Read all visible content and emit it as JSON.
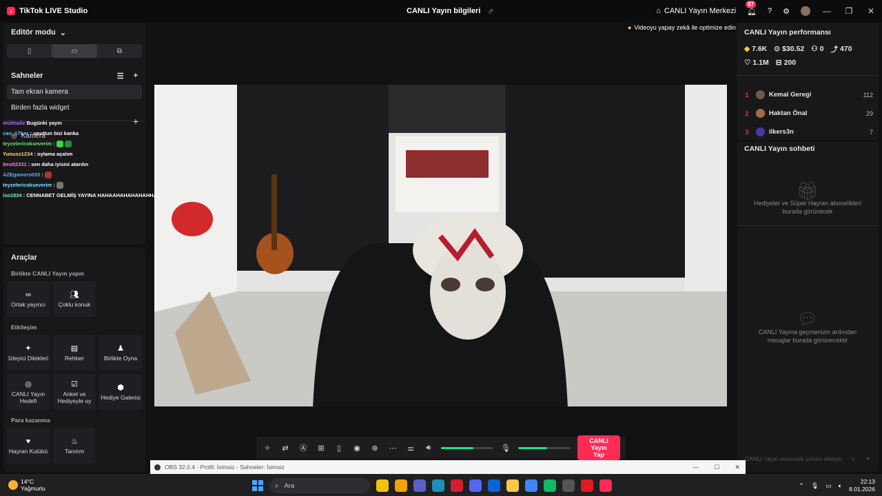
{
  "app": {
    "title": "TikTok LIVE Studio",
    "header_title": "CANLI Yayın bilgileri",
    "live_center": "CANLI Yayın Merkezi",
    "notification_count": "87"
  },
  "editor": {
    "mode_label": "Editör modu",
    "scenes_label": "Sahneler",
    "scenes": [
      "Tam ekran kamera",
      "Birden fazla widget"
    ],
    "camera_source": "Kamera"
  },
  "overlay_chat": [
    {
      "user": "mu̇fmaliz",
      "msg": "Bugünki yayın",
      "cls": "u1"
    },
    {
      "user": "can_17hnr",
      "msg": ": unuttun bizi kanka",
      "cls": "u2"
    },
    {
      "user": "teyzelericokseverim",
      "msg": ":",
      "cls": "u7"
    },
    {
      "user": "Yunuss1234",
      "msg": ": oylama açalım",
      "cls": "u4"
    },
    {
      "user": "bestt2331",
      "msg": ": sen daha iyisini atardın",
      "cls": "u5"
    },
    {
      "user": "AZEgamers033",
      "msg": ":",
      "cls": "u6"
    },
    {
      "user": "teyzelericokseverim",
      "msg": ":",
      "cls": "u7"
    },
    {
      "user": "iso1834",
      "msg": ": CENNABET GELMİŞ YAYINA HAHAAHAHAHAHAHHA",
      "cls": "u8"
    }
  ],
  "tools": {
    "title": "Araçlar",
    "sections": [
      {
        "label": "Birlikte CANLI Yayın yapın",
        "items": [
          {
            "label": "Ortak yayıncı",
            "icon": "link-icon"
          },
          {
            "label": "Çoklu konuk",
            "icon": "users-icon"
          }
        ]
      },
      {
        "label": "Etkileşim",
        "items": [
          {
            "label": "İzleyici Dilekleri",
            "icon": "wish-icon"
          },
          {
            "label": "Rehber",
            "icon": "book-icon"
          },
          {
            "label": "Birlikte Oyna",
            "icon": "play-together-icon"
          },
          {
            "label": "CANLI Yayın Hedefi",
            "icon": "target-icon"
          },
          {
            "label": "Anket ve Hediyeyle oy",
            "icon": "poll-icon"
          },
          {
            "label": "Hediye Galerisi",
            "icon": "gift-gallery-icon"
          }
        ]
      },
      {
        "label": "Para kazanma",
        "items": [
          {
            "label": "Hayran Kulübü",
            "icon": "heart-icon"
          },
          {
            "label": "Tanıtım",
            "icon": "flame-icon"
          }
        ]
      }
    ]
  },
  "video": {
    "optimize_label": "Videoyu yapay zekâ ile optimize edin"
  },
  "controls": {
    "go_live_line1": "CANLI Yayın",
    "go_live_line2": "Yap",
    "volume_level": 0.62,
    "mic_level": 0.55
  },
  "performance": {
    "title": "CANLI Yayın performansı",
    "stats": [
      {
        "icon": "diamond-icon",
        "value": "7.6K"
      },
      {
        "icon": "coin-icon",
        "value": "$30.52"
      },
      {
        "icon": "people-icon",
        "value": "0"
      },
      {
        "icon": "share-icon",
        "value": "470"
      },
      {
        "icon": "heart-icon",
        "value": "1.1M"
      },
      {
        "icon": "gift-icon",
        "value": "200"
      }
    ],
    "top_gifters": [
      {
        "rank": "1",
        "name": "Kemal Geregi",
        "score": "112"
      },
      {
        "rank": "2",
        "name": "Haktan Önal",
        "score": "29"
      },
      {
        "rank": "3",
        "name": "ilkers3n",
        "score": "7"
      }
    ]
  },
  "live_chat": {
    "title": "CANLI Yayın sohbeti",
    "gift_empty": "Hediyeler ve Süper Hayran abonelikleri burada görünecek",
    "msg_empty": "CANLI Yayına geçmenizin ardından mesajlar burada görünecektir",
    "input_placeholder": "CANLI Yayın sırasında yorum ekleyin"
  },
  "obs": {
    "title": "OBS 32.0.4 - Profil: İsimsiz - Sahneler: İsimsiz"
  },
  "taskbar": {
    "temp": "14°C",
    "weather": "Yağmurlu",
    "search_placeholder": "Ara",
    "time": "22:13",
    "date": "8.01.2026"
  },
  "colors": {
    "accent": "#fe2c55",
    "slider": "#21e08e",
    "panel": "#18181b"
  }
}
